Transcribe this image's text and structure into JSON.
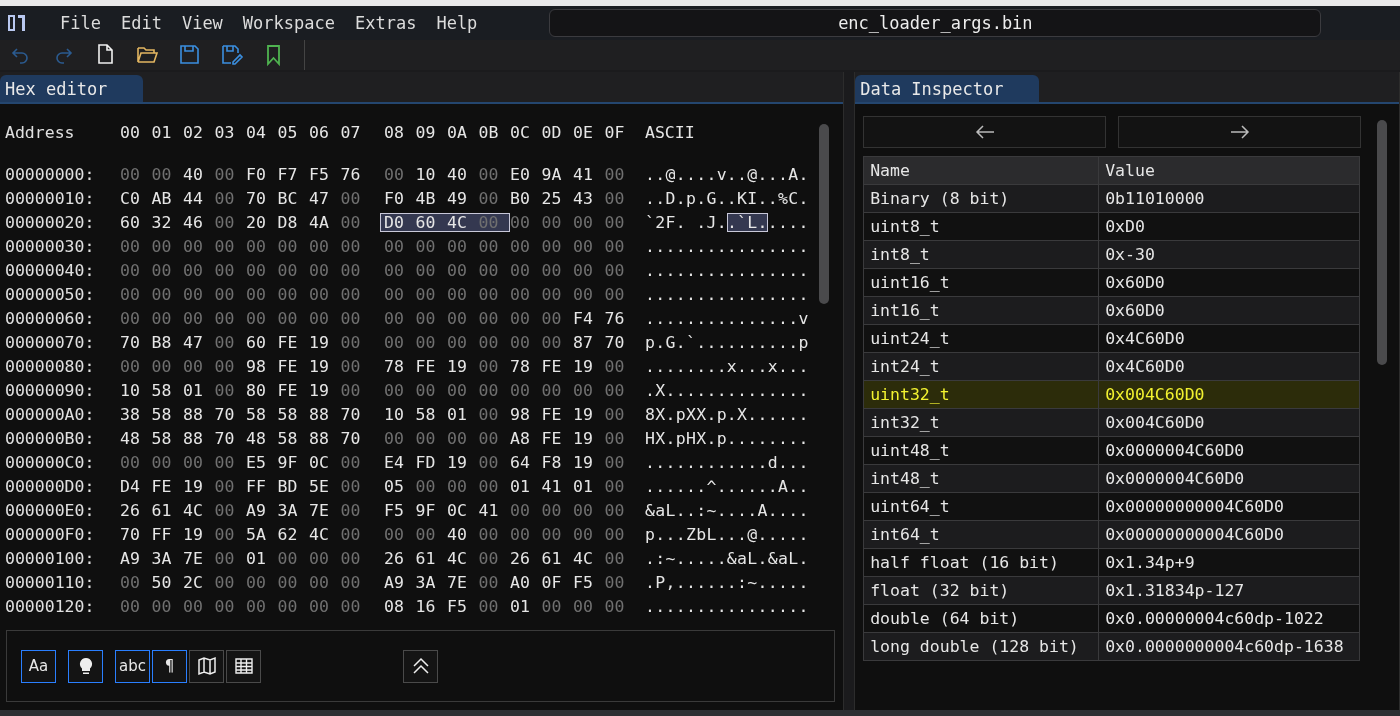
{
  "menu": [
    "File",
    "Edit",
    "View",
    "Workspace",
    "Extras",
    "Help"
  ],
  "title_field": "enc_loader_args.bin",
  "toolbar": [
    {
      "kind": "undo",
      "disabled": true
    },
    {
      "kind": "redo",
      "disabled": true
    },
    {
      "kind": "new",
      "disabled": false
    },
    {
      "kind": "open",
      "disabled": false
    },
    {
      "kind": "save",
      "disabled": false
    },
    {
      "kind": "save_as",
      "disabled": false
    },
    {
      "kind": "bookmark",
      "disabled": false
    }
  ],
  "hex_editor": {
    "tab": "Hex editor",
    "header": {
      "address": "Address",
      "columns": [
        "00",
        "01",
        "02",
        "03",
        "04",
        "05",
        "06",
        "07",
        "08",
        "09",
        "0A",
        "0B",
        "0C",
        "0D",
        "0E",
        "0F"
      ],
      "ascii": "ASCII"
    },
    "rows": [
      {
        "address": "00000000:",
        "segments": [
          {
            "bytes": "00 00 40 00 F0 F7 F5 76 00 10 40 00 E0 9A 41 00",
            "ascii": "..@....v..@...A.",
            "selected": false
          }
        ]
      },
      {
        "address": "00000010:",
        "segments": [
          {
            "bytes": "C0 AB 44 00 70 BC 47 00 F0 4B 49 00 B0 25 43 00",
            "ascii": "..D.p.G..KI..%C.",
            "selected": false
          }
        ]
      },
      {
        "address": "00000020:",
        "segments": [
          {
            "bytes": "60 32 46 00 20 D8 4A 00",
            "ascii": "`2F. .J.",
            "selected": false
          },
          {
            "bytes": "D0 60 4C 00",
            "ascii": ".`L.",
            "selected": true
          },
          {
            "bytes": "00 00 00 00",
            "ascii": "....",
            "selected": false
          }
        ]
      },
      {
        "address": "00000030:",
        "segments": [
          {
            "bytes": "00 00 00 00 00 00 00 00 00 00 00 00 00 00 00 00",
            "ascii": "................",
            "selected": false
          }
        ]
      },
      {
        "address": "00000040:",
        "segments": [
          {
            "bytes": "00 00 00 00 00 00 00 00 00 00 00 00 00 00 00 00",
            "ascii": "................",
            "selected": false
          }
        ]
      },
      {
        "address": "00000050:",
        "segments": [
          {
            "bytes": "00 00 00 00 00 00 00 00 00 00 00 00 00 00 00 00",
            "ascii": "................",
            "selected": false
          }
        ]
      },
      {
        "address": "00000060:",
        "segments": [
          {
            "bytes": "00 00 00 00 00 00 00 00 00 00 00 00 00 00 F4 76",
            "ascii": "...............v",
            "selected": false
          }
        ]
      },
      {
        "address": "00000070:",
        "segments": [
          {
            "bytes": "70 B8 47 00 60 FE 19 00 00 00 00 00 00 00 87 70",
            "ascii": "p.G.`..........p",
            "selected": false
          }
        ]
      },
      {
        "address": "00000080:",
        "segments": [
          {
            "bytes": "00 00 00 00 98 FE 19 00 78 FE 19 00 78 FE 19 00",
            "ascii": "........x...x...",
            "selected": false
          }
        ]
      },
      {
        "address": "00000090:",
        "segments": [
          {
            "bytes": "10 58 01 00 80 FE 19 00 00 00 00 00 00 00 00 00",
            "ascii": ".X..............",
            "selected": false
          }
        ]
      },
      {
        "address": "000000A0:",
        "segments": [
          {
            "bytes": "38 58 88 70 58 58 88 70 10 58 01 00 98 FE 19 00",
            "ascii": "8X.pXX.p.X......",
            "selected": false
          }
        ]
      },
      {
        "address": "000000B0:",
        "segments": [
          {
            "bytes": "48 58 88 70 48 58 88 70 00 00 00 00 A8 FE 19 00",
            "ascii": "HX.pHX.p........",
            "selected": false
          }
        ]
      },
      {
        "address": "000000C0:",
        "segments": [
          {
            "bytes": "00 00 00 00 E5 9F 0C 00 E4 FD 19 00 64 F8 19 00",
            "ascii": "............d...",
            "selected": false
          }
        ]
      },
      {
        "address": "000000D0:",
        "segments": [
          {
            "bytes": "D4 FE 19 00 FF BD 5E 00 05 00 00 00 01 41 01 00",
            "ascii": "......^......A..",
            "selected": false
          }
        ]
      },
      {
        "address": "000000E0:",
        "segments": [
          {
            "bytes": "26 61 4C 00 A9 3A 7E 00 F5 9F 0C 41 00 00 00 00",
            "ascii": "&aL..:~....A....",
            "selected": false
          }
        ]
      },
      {
        "address": "000000F0:",
        "segments": [
          {
            "bytes": "70 FF 19 00 5A 62 4C 00 00 00 40 00 00 00 00 00",
            "ascii": "p...ZbL...@.....",
            "selected": false
          }
        ]
      },
      {
        "address": "00000100:",
        "segments": [
          {
            "bytes": "A9 3A 7E 00 01 00 00 00 26 61 4C 00 26 61 4C 00",
            "ascii": ".:~.....&aL.&aL.",
            "selected": false
          }
        ]
      },
      {
        "address": "00000110:",
        "segments": [
          {
            "bytes": "00 50 2C 00 00 00 00 00 A9 3A 7E 00 A0 0F F5 00",
            "ascii": ".P,......:~.....",
            "selected": false
          }
        ]
      },
      {
        "address": "00000120:",
        "segments": [
          {
            "bytes": "00 00 00 00 00 00 00 00 08 16 F5 00 01 00 00 00",
            "ascii": "................",
            "selected": false
          }
        ]
      }
    ],
    "tool_groups": [
      [
        {
          "kind": "text",
          "label": "Aa",
          "on": true
        }
      ],
      [
        {
          "kind": "bulb",
          "on": true
        }
      ],
      [
        {
          "kind": "text",
          "label": "abc",
          "on": true
        },
        {
          "kind": "text",
          "label": "¶",
          "on": true
        },
        {
          "kind": "map",
          "on": false
        },
        {
          "kind": "table",
          "on": false
        }
      ]
    ]
  },
  "inspector": {
    "tab": "Data Inspector",
    "columns": [
      "Name",
      "Value"
    ],
    "rows": [
      {
        "name": "Binary (8 bit)",
        "value": "0b11010000",
        "selected": false
      },
      {
        "name": "uint8_t",
        "value": "0xD0",
        "selected": false
      },
      {
        "name": "int8_t",
        "value": "0x-30",
        "selected": false
      },
      {
        "name": "uint16_t",
        "value": "0x60D0",
        "selected": false
      },
      {
        "name": "int16_t",
        "value": "0x60D0",
        "selected": false
      },
      {
        "name": "uint24_t",
        "value": "0x4C60D0",
        "selected": false
      },
      {
        "name": "int24_t",
        "value": "0x4C60D0",
        "selected": false
      },
      {
        "name": "uint32_t",
        "value": "0x004C60D0",
        "selected": true
      },
      {
        "name": "int32_t",
        "value": "0x004C60D0",
        "selected": false
      },
      {
        "name": "uint48_t",
        "value": "0x0000004C60D0",
        "selected": false
      },
      {
        "name": "int48_t",
        "value": "0x0000004C60D0",
        "selected": false
      },
      {
        "name": "uint64_t",
        "value": "0x00000000004C60D0",
        "selected": false
      },
      {
        "name": "int64_t",
        "value": "0x00000000004C60D0",
        "selected": false
      },
      {
        "name": "half float (16 bit)",
        "value": "0x1.34p+9",
        "selected": false
      },
      {
        "name": "float (32 bit)",
        "value": "0x1.31834p-127",
        "selected": false
      },
      {
        "name": "double (64 bit)",
        "value": "0x0.00000004c60dp-1022",
        "selected": false
      },
      {
        "name": "long double (128 bit)",
        "value": "0x0.0000000004c60dp-1638",
        "selected": false
      }
    ]
  }
}
